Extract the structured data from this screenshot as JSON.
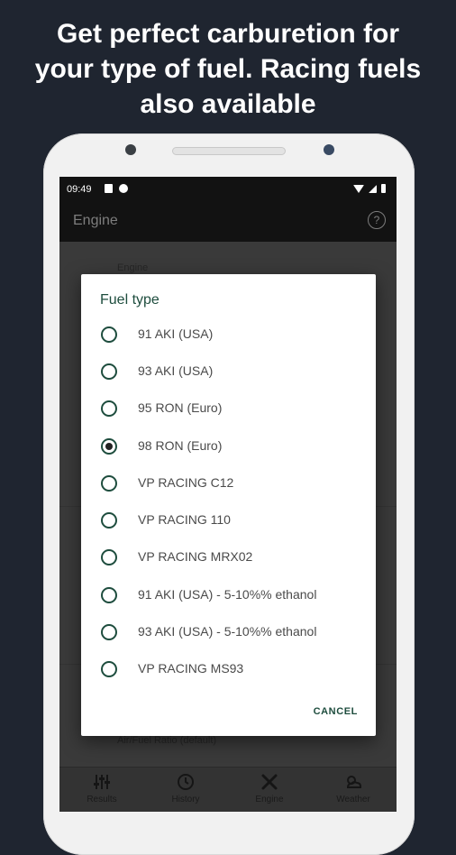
{
  "headline": {
    "line1": "Get perfect carburetion for",
    "line2": "your type of fuel. Racing fuels",
    "line3": "also available"
  },
  "status_bar": {
    "time": "09:49"
  },
  "app_bar": {
    "title": "Engine",
    "help_icon": "?"
  },
  "background": {
    "engine_label": "Engine",
    "afr_label": "Air/Fuel Ratio (default)"
  },
  "dialog": {
    "title": "Fuel type",
    "selected_index": 3,
    "options": [
      {
        "label": "91 AKI (USA)",
        "checked": false
      },
      {
        "label": "93 AKI (USA)",
        "checked": false
      },
      {
        "label": "95 RON (Euro)",
        "checked": false
      },
      {
        "label": "98 RON (Euro)",
        "checked": true
      },
      {
        "label": "VP RACING C12",
        "checked": false
      },
      {
        "label": "VP RACING 110",
        "checked": false
      },
      {
        "label": "VP RACING MRX02",
        "checked": false
      },
      {
        "label": "91 AKI (USA) - 5-10%% ethanol",
        "checked": false
      },
      {
        "label": "93 AKI (USA) - 5-10%% ethanol",
        "checked": false
      },
      {
        "label": "VP RACING MS93",
        "checked": false
      }
    ],
    "cancel_label": "CANCEL"
  },
  "bottom_nav": {
    "items": [
      {
        "label": "Results",
        "icon": "sliders-icon"
      },
      {
        "label": "History",
        "icon": "clock-icon"
      },
      {
        "label": "Engine",
        "icon": "wrench-icon"
      },
      {
        "label": "Weather",
        "icon": "weather-icon"
      }
    ]
  },
  "colors": {
    "background": "#1f2530",
    "accent": "#1e4d3e",
    "dialog": "#ffffff"
  }
}
